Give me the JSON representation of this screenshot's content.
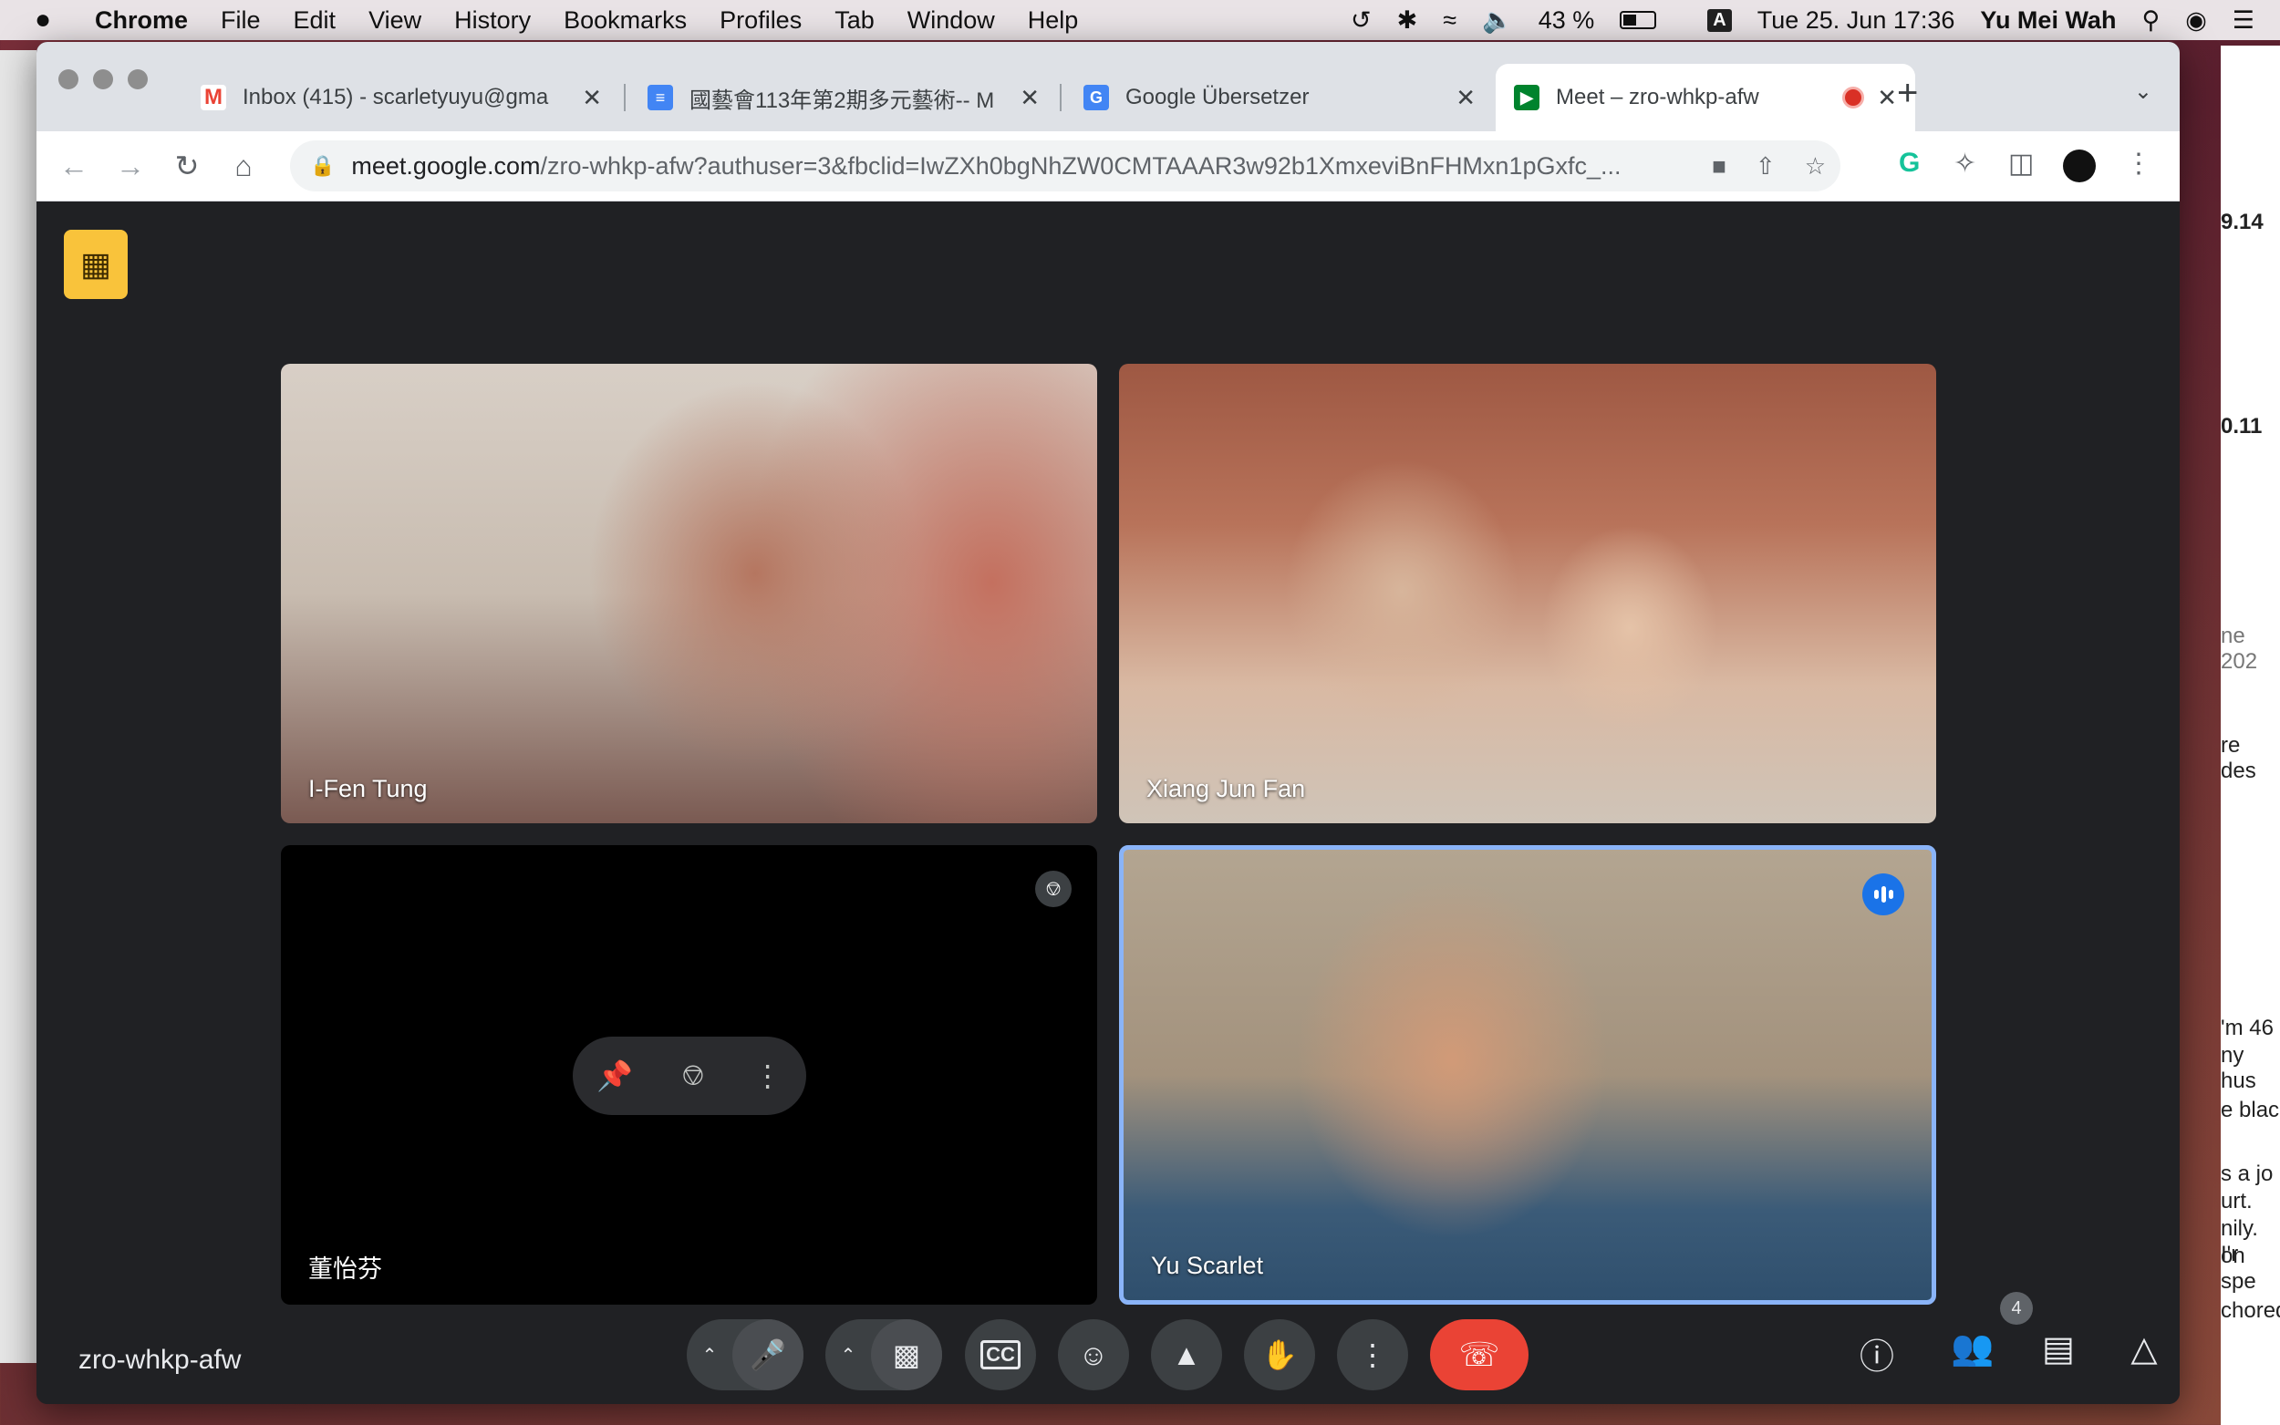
{
  "menubar": {
    "apple": "",
    "app": "Chrome",
    "items": [
      "File",
      "Edit",
      "View",
      "History",
      "Bookmarks",
      "Profiles",
      "Tab",
      "Window",
      "Help"
    ],
    "battery_percent": "43 %",
    "battery_level": 0.43,
    "input_source": "A",
    "datetime": "Tue 25. Jun  17:36",
    "user": "Yu Mei Wah"
  },
  "background_window": {
    "fragments": [
      "9.14",
      "0.11",
      "ne 202",
      "re des",
      "'m 46",
      "ny hus",
      "e blac",
      "s a jo",
      "urt.",
      "nily. I'r",
      "on spe",
      "chored"
    ]
  },
  "tabs": [
    {
      "title": "Inbox (415) - scarletyuyu@gma",
      "icon": "gmail-icon"
    },
    {
      "title": "國藝會113年第2期多元藝術-- M",
      "icon": "docs-icon"
    },
    {
      "title": "Google Übersetzer",
      "icon": "translate-icon"
    },
    {
      "title": "Meet – zro-whkp-afw",
      "icon": "meet-icon"
    }
  ],
  "toolbar": {
    "url_host": "meet.google.com",
    "url_path": "/zro-whkp-afw?authuser=3&fbclid=IwZXh0bgNhZW0CMTAAAR3w92b1XmxeviBnFHMxn1pGxfc_..."
  },
  "meet": {
    "meeting_code": "zro-whkp-afw",
    "participants": [
      {
        "name": "I-Fen Tung"
      },
      {
        "name": "Xiang Jun Fan"
      },
      {
        "name": "董怡芬"
      },
      {
        "name": "Yu Scarlet"
      }
    ],
    "participant_count": "4"
  },
  "colors": {
    "meet_bg": "#202124",
    "hangup": "#ea4335",
    "speaking_border": "#8ab4f8",
    "badge": "#f9c33b"
  }
}
